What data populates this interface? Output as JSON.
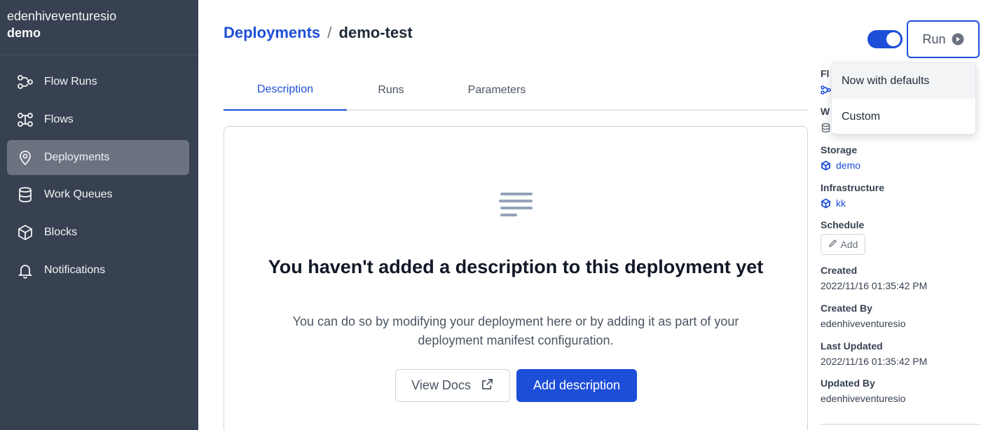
{
  "sidebar": {
    "account_name": "edenhiveventuresio",
    "workspace_name": "demo",
    "items": [
      {
        "label": "Flow Runs",
        "icon": "flow-runs-icon"
      },
      {
        "label": "Flows",
        "icon": "flows-icon"
      },
      {
        "label": "Deployments",
        "icon": "deployments-icon",
        "active": true
      },
      {
        "label": "Work Queues",
        "icon": "database-icon"
      },
      {
        "label": "Blocks",
        "icon": "cube-icon"
      },
      {
        "label": "Notifications",
        "icon": "bell-icon"
      }
    ]
  },
  "header": {
    "breadcrumb_root": "Deployments",
    "breadcrumb_separator": "/",
    "breadcrumb_current": "demo-test",
    "schedule_toggle_on": true,
    "run_label": "Run"
  },
  "tabs": [
    {
      "label": "Description",
      "active": true
    },
    {
      "label": "Runs",
      "active": false
    },
    {
      "label": "Parameters",
      "active": false
    }
  ],
  "empty_state": {
    "title": "You haven't added a description to this deployment yet",
    "text": "You can do so by modifying your deployment here or by adding it as part of your deployment manifest configuration.",
    "view_docs_label": "View Docs",
    "add_description_label": "Add description"
  },
  "run_menu": {
    "items": [
      "Now with defaults",
      "Custom"
    ]
  },
  "details": {
    "flow_label_partial": "Fl",
    "work_queue_label_partial": "W",
    "storage_label": "Storage",
    "storage_value": "demo",
    "infrastructure_label": "Infrastructure",
    "infrastructure_value": "kk",
    "schedule_label": "Schedule",
    "schedule_add_label": "Add",
    "created_label": "Created",
    "created_value": "2022/11/16 01:35:42 PM",
    "created_by_label": "Created By",
    "created_by_value": "edenhiveventuresio",
    "last_updated_label": "Last Updated",
    "last_updated_value": "2022/11/16 01:35:42 PM",
    "updated_by_label": "Updated By",
    "updated_by_value": "edenhiveventuresio"
  },
  "colors": {
    "sidebar_bg": "#374151",
    "sidebar_active": "#6b7280",
    "accent": "#1d4ed8"
  }
}
